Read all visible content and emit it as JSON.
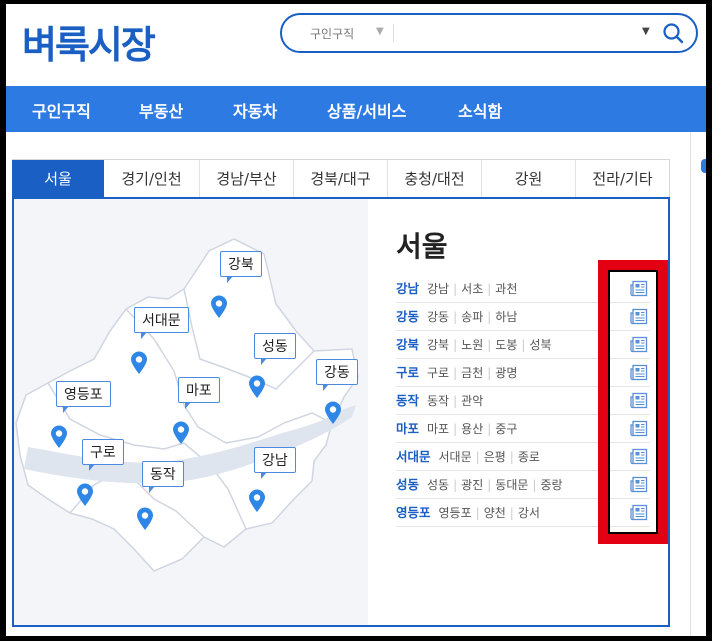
{
  "header": {
    "logo": "벼룩시장",
    "search": {
      "category": "구인구직",
      "placeholder": ""
    }
  },
  "nav": {
    "items": [
      "구인구직",
      "부동산",
      "자동차",
      "상품/서비스",
      "소식함"
    ]
  },
  "tabs": [
    "서울",
    "경기/인천",
    "경남/부산",
    "경북/대구",
    "충청/대전",
    "강원",
    "전라/기타"
  ],
  "active_tab": "서울",
  "map": {
    "labels": [
      "강북",
      "서대문",
      "성동",
      "강동",
      "영등포",
      "마포",
      "구로",
      "동작",
      "강남"
    ]
  },
  "region": {
    "title": "서울",
    "rows": [
      {
        "key": "강남",
        "subs": [
          "강남",
          "서초",
          "과천"
        ]
      },
      {
        "key": "강동",
        "subs": [
          "강동",
          "송파",
          "하남"
        ]
      },
      {
        "key": "강북",
        "subs": [
          "강북",
          "노원",
          "도봉",
          "성북"
        ]
      },
      {
        "key": "구로",
        "subs": [
          "구로",
          "금천",
          "광명"
        ]
      },
      {
        "key": "동작",
        "subs": [
          "동작",
          "관악"
        ]
      },
      {
        "key": "마포",
        "subs": [
          "마포",
          "용산",
          "중구"
        ]
      },
      {
        "key": "서대문",
        "subs": [
          "서대문",
          "은평",
          "종로"
        ]
      },
      {
        "key": "성동",
        "subs": [
          "성동",
          "광진",
          "동대문",
          "중랑"
        ]
      },
      {
        "key": "영등포",
        "subs": [
          "영등포",
          "양천",
          "강서"
        ]
      }
    ]
  },
  "colors": {
    "brand": "#1a5fc4",
    "nav": "#2e7ae3",
    "highlight": "#e30012"
  }
}
